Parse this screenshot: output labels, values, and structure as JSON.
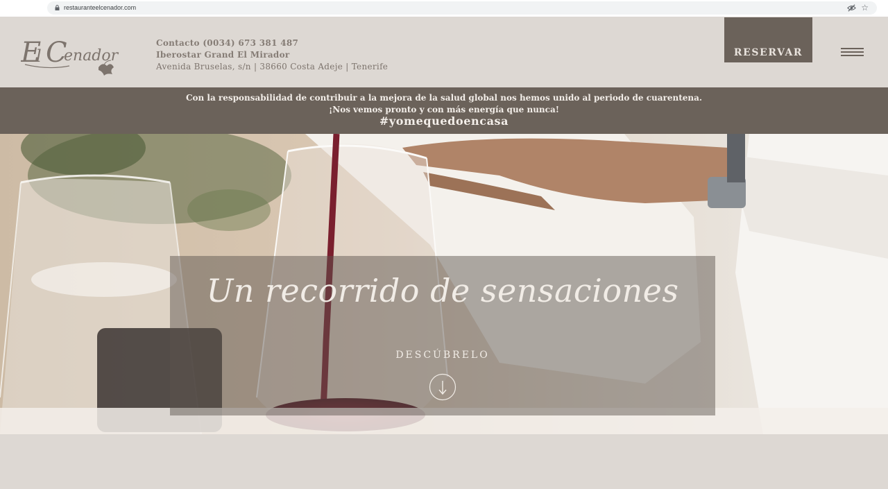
{
  "browser": {
    "url": "restauranteelcenador.com",
    "lock_icon": "lock-icon",
    "eye_icon": "eye-off-icon",
    "star_icon": "star-icon",
    "star_glyph": "☆"
  },
  "header": {
    "logo_text": "El Cenador",
    "contact_line": "Contacto (0034) 673 381 487",
    "hotel_line": "Iberostar Grand El Mirador",
    "address_line": "Avenida Bruselas, s/n | 38660 Costa Adeje | Tenerife",
    "reserve_label": "RESERVAR",
    "menu_icon": "hamburger-menu-icon"
  },
  "notice": {
    "line1": "Con la responsabilidad de contribuir a la mejora de la salud global nos hemos unido al periodo de cuarentena.",
    "line2": "¡Nos vemos pronto y con más energía que nunca!",
    "hashtag": "#yomequedoencasa"
  },
  "hero": {
    "title": "Un recorrido de sensaciones",
    "discover_label": "DESCÚBRELO",
    "arrow_icon": "arrow-down-circle-icon"
  },
  "colors": {
    "page_bg": "#ddd8d3",
    "accent": "#6b625a",
    "text_light": "#f1ece6"
  }
}
